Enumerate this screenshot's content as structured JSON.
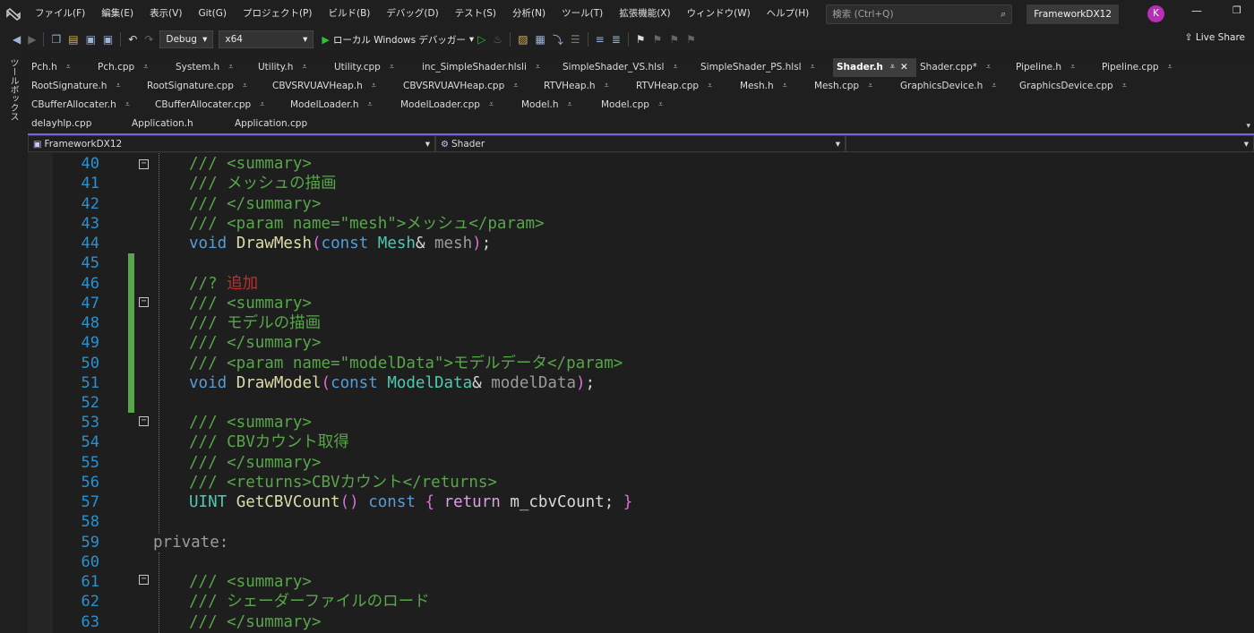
{
  "menubar": {
    "items": [
      "ファイル(F)",
      "編集(E)",
      "表示(V)",
      "Git(G)",
      "プロジェクト(P)",
      "ビルド(B)",
      "デバッグ(D)",
      "テスト(S)",
      "分析(N)",
      "ツール(T)",
      "拡張機能(X)",
      "ウィンドウ(W)",
      "ヘルプ(H)"
    ],
    "search_placeholder": "検索 (Ctrl+Q)",
    "solution_name": "FrameworkDX12",
    "avatar_initial": "K"
  },
  "toolbar": {
    "configuration": "Debug",
    "platform": "x64",
    "run_label": "ローカル Windows デバッガー",
    "live_share": "Live Share"
  },
  "toolbox_label": "ツールボックス",
  "tabs": {
    "row1": [
      {
        "label": "Pch.h"
      },
      {
        "label": "Pch.cpp"
      },
      {
        "label": "System.h"
      },
      {
        "label": "Utility.h"
      },
      {
        "label": "Utility.cpp"
      },
      {
        "label": "inc_SimpleShader.hlsli"
      },
      {
        "label": "SimpleShader_VS.hlsl"
      },
      {
        "label": "SimpleShader_PS.hlsl"
      },
      {
        "label": "Shader.h",
        "active": true
      },
      {
        "label": "Shader.cpp*"
      },
      {
        "label": "Pipeline.h"
      },
      {
        "label": "Pipeline.cpp"
      }
    ],
    "row2": [
      {
        "label": "RootSignature.h"
      },
      {
        "label": "RootSignature.cpp"
      },
      {
        "label": "CBVSRVUAVHeap.h"
      },
      {
        "label": "CBVSRVUAVHeap.cpp"
      },
      {
        "label": "RTVHeap.h"
      },
      {
        "label": "RTVHeap.cpp"
      },
      {
        "label": "Mesh.h"
      },
      {
        "label": "Mesh.cpp"
      },
      {
        "label": "GraphicsDevice.h"
      },
      {
        "label": "GraphicsDevice.cpp"
      }
    ],
    "row3": [
      {
        "label": "CBufferAllocater.h"
      },
      {
        "label": "CBufferAllocater.cpp"
      },
      {
        "label": "ModelLoader.h"
      },
      {
        "label": "ModelLoader.cpp"
      },
      {
        "label": "Model.h"
      },
      {
        "label": "Model.cpp"
      }
    ],
    "row4": [
      {
        "label": "delayhlp.cpp"
      },
      {
        "label": "Application.h"
      },
      {
        "label": "Application.cpp"
      }
    ]
  },
  "navbar": {
    "project": "FrameworkDX12",
    "scope": "Shader",
    "member": ""
  },
  "editor": {
    "line_numbers": [
      "40",
      "41",
      "42",
      "43",
      "44",
      "45",
      "46",
      "47",
      "48",
      "49",
      "50",
      "51",
      "52",
      "53",
      "54",
      "55",
      "56",
      "57",
      "58",
      "59",
      "60",
      "61",
      "62",
      "63"
    ],
    "code": {
      "l40": "/// <summary>",
      "l41": "/// メッシュの描画",
      "l42": "/// </summary>",
      "l43": "/// <param name=\"mesh\">メッシュ</param>",
      "l44_kw": "void",
      "l44_fn": "DrawMesh",
      "l44_const": "const",
      "l44_type": "Mesh",
      "l44_param": "mesh",
      "l46_prefix": "//?",
      "l46_text": "追加",
      "l47": "/// <summary>",
      "l48": "/// モデルの描画",
      "l49": "/// </summary>",
      "l50": "/// <param name=\"modelData\">モデルデータ</param>",
      "l51_kw": "void",
      "l51_fn": "DrawModel",
      "l51_const": "const",
      "l51_type": "ModelData",
      "l51_param": "modelData",
      "l53": "/// <summary>",
      "l54": "/// CBVカウント取得",
      "l55": "/// </summary>",
      "l56": "/// <returns>CBVカウント</returns>",
      "l57_type": "UINT",
      "l57_fn": "GetCBVCount",
      "l57_const": "const",
      "l57_ret": "return",
      "l57_id": "m_cbvCount",
      "l59": "private:",
      "l61": "/// <summary>",
      "l62": "/// シェーダーファイルのロード",
      "l63": "/// </summary>"
    }
  }
}
